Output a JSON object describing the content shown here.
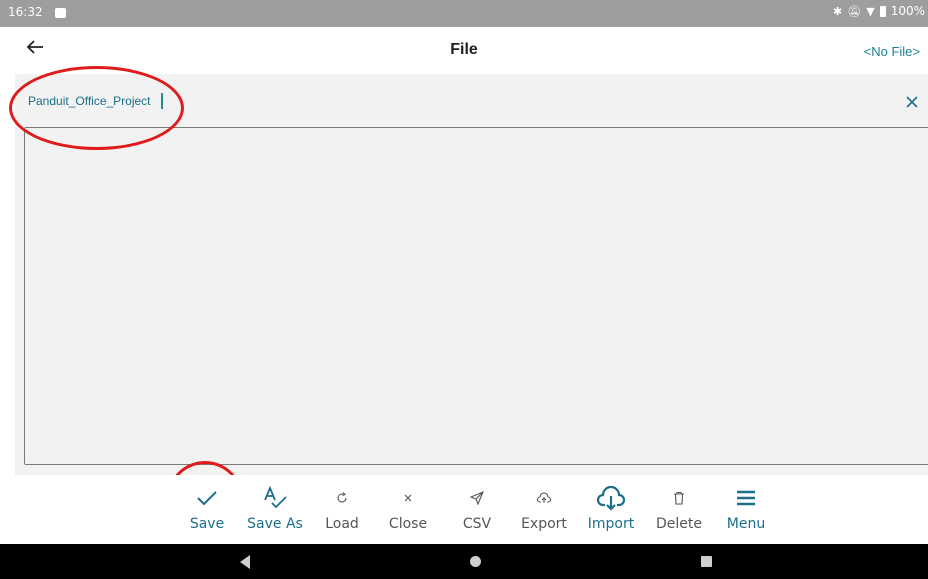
{
  "status_bar": {
    "time": "16:32",
    "battery": "100%",
    "icons": [
      "image-icon",
      "bluetooth-icon",
      "mute-icon",
      "wifi-icon",
      "battery-icon"
    ]
  },
  "app_bar": {
    "title": "File",
    "file_name": "<No File>"
  },
  "editor": {
    "name_value": "Panduit_Office_Project",
    "clear_icon": "close-icon"
  },
  "toolbar": {
    "items": [
      {
        "label": "Save",
        "icon": "check-icon"
      },
      {
        "label": "Save As",
        "icon": "spellcheck-icon"
      },
      {
        "label": "Load",
        "icon": "refresh-icon"
      },
      {
        "label": "Close",
        "icon": "close-icon"
      },
      {
        "label": "CSV",
        "icon": "send-icon"
      },
      {
        "label": "Export",
        "icon": "cloud-upload-icon"
      },
      {
        "label": "Import",
        "icon": "cloud-download-icon"
      },
      {
        "label": "Delete",
        "icon": "trash-icon"
      },
      {
        "label": "Menu",
        "icon": "menu-icon"
      }
    ]
  },
  "colors": {
    "accent": "#1b6f8b",
    "annotation": "#e01b1b",
    "status_bar": "#9e9e9e",
    "content_bg": "#f2f2f2"
  }
}
